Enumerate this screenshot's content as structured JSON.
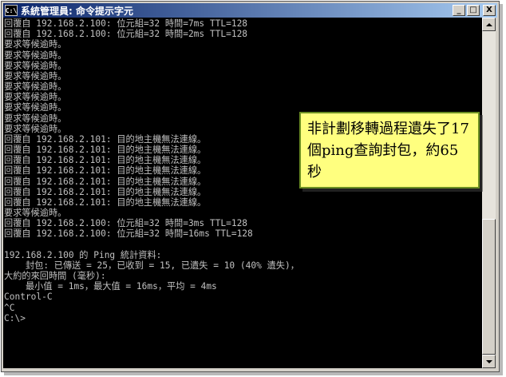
{
  "window": {
    "title": "系統管理員: 命令提示字元",
    "app_icon_text": "C:\\",
    "buttons": {
      "minimize": "_",
      "maximize": "□",
      "close": "X"
    }
  },
  "console": {
    "lines": [
      "回覆自 192.168.2.100: 位元組=32 時間=7ms TTL=128",
      "回覆自 192.168.2.100: 位元組=32 時間=2ms TTL=128",
      "要求等候逾時。",
      "要求等候逾時。",
      "要求等候逾時。",
      "要求等候逾時。",
      "要求等候逾時。",
      "要求等候逾時。",
      "要求等候逾時。",
      "要求等候逾時。",
      "要求等候逾時。",
      "回覆自 192.168.2.101: 目的地主機無法連線。",
      "回覆自 192.168.2.101: 目的地主機無法連線。",
      "回覆自 192.168.2.101: 目的地主機無法連線。",
      "回覆自 192.168.2.101: 目的地主機無法連線。",
      "回覆自 192.168.2.101: 目的地主機無法連線。",
      "回覆自 192.168.2.101: 目的地主機無法連線。",
      "回覆自 192.168.2.101: 目的地主機無法連線。",
      "要求等候逾時。",
      "回覆自 192.168.2.100: 位元組=32 時間=3ms TTL=128",
      "回覆自 192.168.2.100: 位元組=32 時間=16ms TTL=128",
      "",
      "192.168.2.100 的 Ping 統計資料:",
      "    封包: 已傳送 = 25，已收到 = 15, 已遺失 = 10 (40% 遺失)，",
      "大約的來回時間 (毫秒):",
      "    最小值 = 1ms，最大值 = 16ms，平均 = 4ms",
      "Control-C",
      "^C",
      "C:\\>"
    ]
  },
  "callout": {
    "text": "非計劃移轉過程遺失了17個ping查詢封包，約65秒"
  }
}
